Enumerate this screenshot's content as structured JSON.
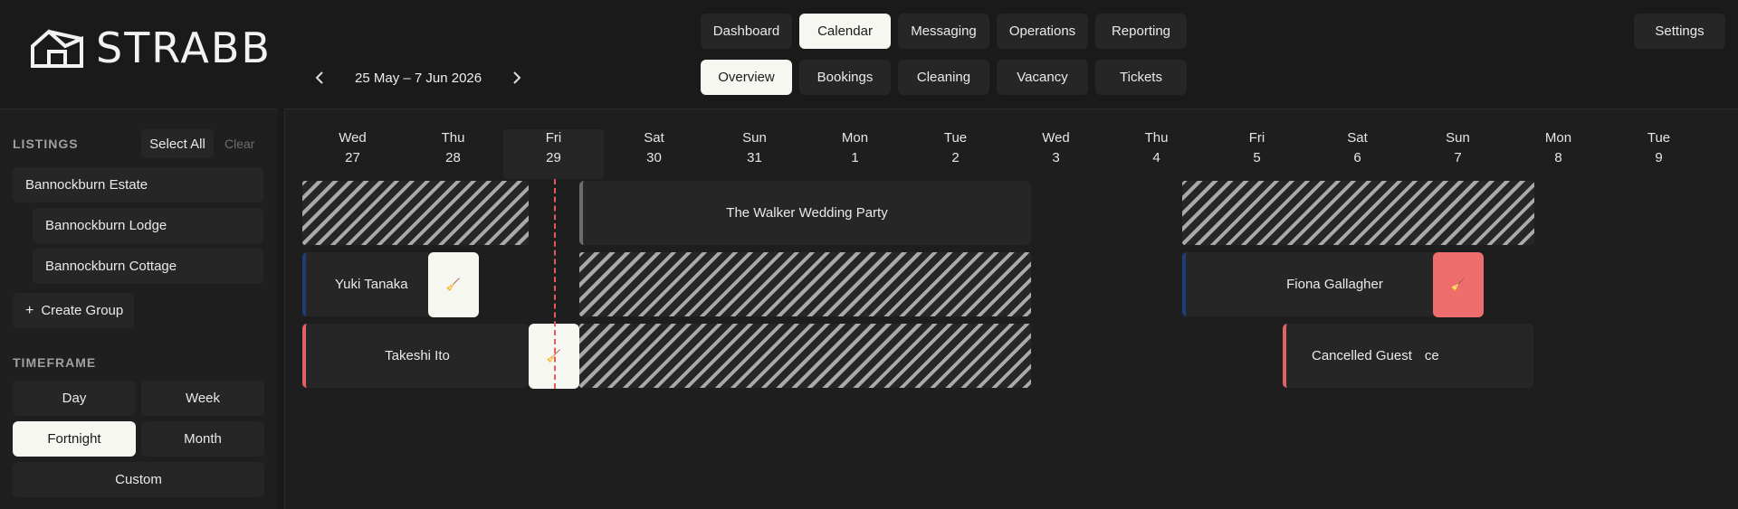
{
  "app": {
    "logo_text": "STRABB"
  },
  "nav": {
    "primary": [
      "Dashboard",
      "Calendar",
      "Messaging",
      "Operations",
      "Reporting"
    ],
    "primary_active": "Calendar",
    "secondary": [
      "Overview",
      "Bookings",
      "Cleaning",
      "Vacancy",
      "Tickets"
    ],
    "secondary_active": "Overview",
    "settings": "Settings"
  },
  "date_range": "25 May – 7 Jun 2026",
  "sidebar": {
    "listings_title": "LISTINGS",
    "select_all": "Select All",
    "clear": "Clear",
    "listings": [
      "Bannockburn Estate",
      "Bannockburn Lodge",
      "Bannockburn Cottage"
    ],
    "create_group": "Create Group",
    "timeframe_title": "TIMEFRAME",
    "timeframes": [
      "Day",
      "Week",
      "Fortnight",
      "Month",
      "Custom"
    ],
    "timeframe_selected": "Fortnight"
  },
  "calendar": {
    "days": [
      {
        "name": "Wed",
        "date": "27"
      },
      {
        "name": "Thu",
        "date": "28"
      },
      {
        "name": "Fri",
        "date": "29"
      },
      {
        "name": "Sat",
        "date": "30"
      },
      {
        "name": "Sun",
        "date": "31"
      },
      {
        "name": "Mon",
        "date": "1"
      },
      {
        "name": "Tue",
        "date": "2"
      },
      {
        "name": "Wed",
        "date": "3"
      },
      {
        "name": "Thu",
        "date": "4"
      },
      {
        "name": "Fri",
        "date": "5"
      },
      {
        "name": "Sat",
        "date": "6"
      },
      {
        "name": "Sun",
        "date": "7"
      },
      {
        "name": "Mon",
        "date": "8"
      },
      {
        "name": "Tue",
        "date": "9"
      }
    ],
    "today": "Fri 29",
    "bookings": {
      "walker": "The Walker Wedding Party",
      "yuki": "Yuki Tanaka",
      "fiona": "Fiona Gallagher",
      "takeshi": "Takeshi Ito",
      "cancelled": "Cancelled Guest",
      "cancelled_suffix": "ce"
    },
    "cleaning_glyph": "🧹"
  },
  "colors": {
    "accent_blue": "#1f3d7a",
    "accent_red": "#e06262",
    "today_line": "#e35b5b"
  }
}
